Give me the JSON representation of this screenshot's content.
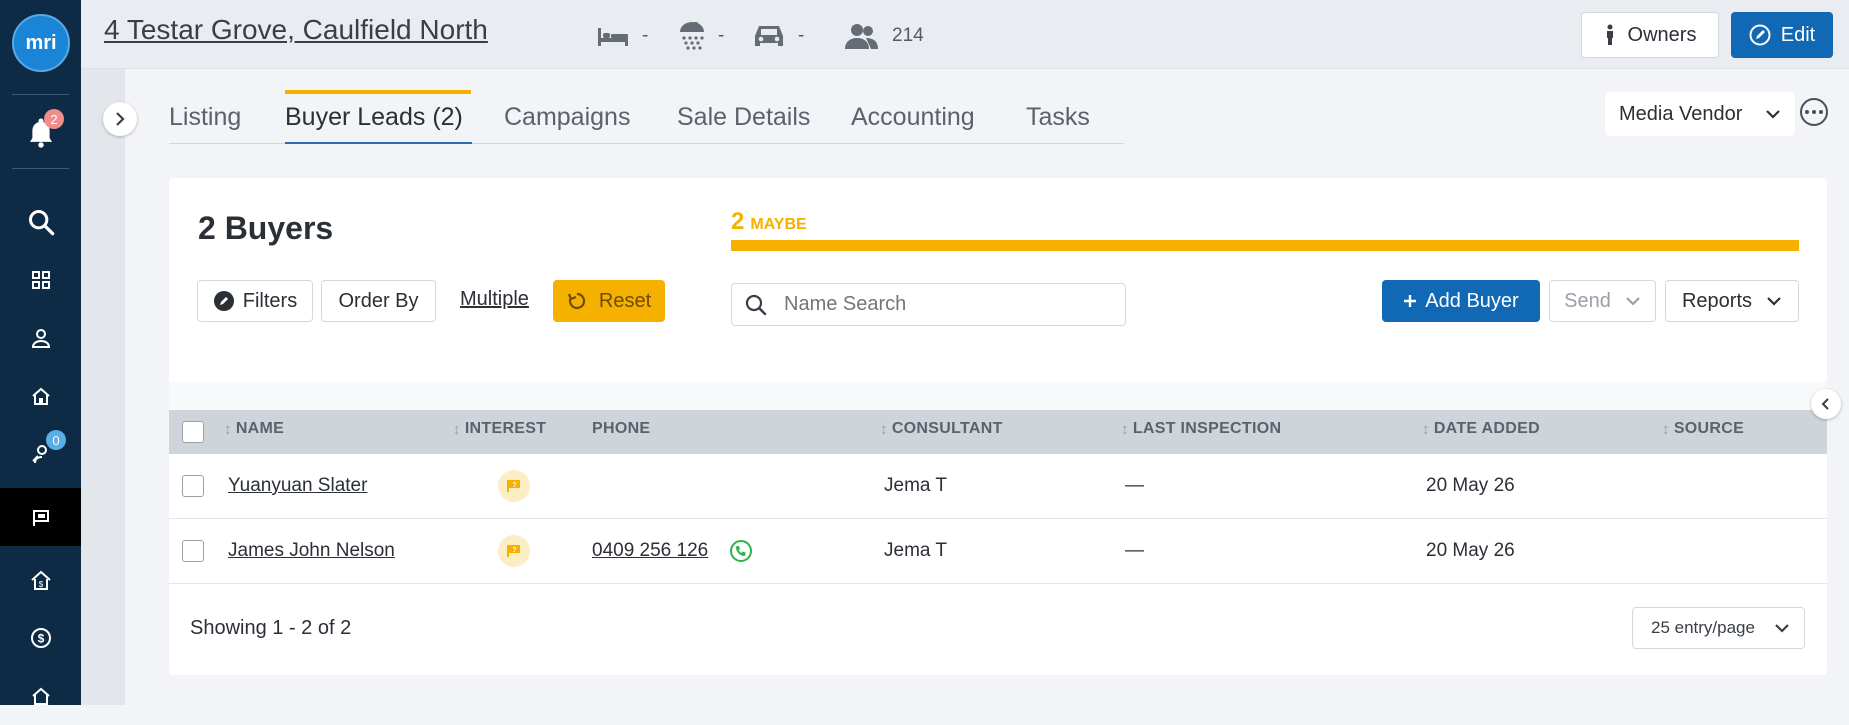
{
  "app": {
    "logo_text": "mri",
    "notifications_count": "2",
    "tasks_count": "0"
  },
  "colors": {
    "sidebar": "#0d2b45",
    "accent_blue": "#1168b4",
    "maybe_yellow": "#f5b000"
  },
  "sidebar": {
    "items": [
      {
        "icon": "bell-icon"
      },
      {
        "icon": "search-icon"
      },
      {
        "icon": "grid-icon"
      },
      {
        "icon": "person-icon"
      },
      {
        "icon": "home-icon"
      },
      {
        "icon": "key-person-icon"
      },
      {
        "icon": "listing-sign-icon"
      },
      {
        "icon": "house-dollar-icon"
      },
      {
        "icon": "dollar-circle-icon"
      },
      {
        "icon": "house-icon"
      }
    ]
  },
  "header": {
    "address": "4 Testar Grove, Caulfield North",
    "bedrooms": "-",
    "bathrooms": "-",
    "carspaces": "-",
    "contacts": "214",
    "owners_label": "Owners",
    "edit_label": "Edit"
  },
  "tabs": [
    {
      "label": "Listing"
    },
    {
      "label": "Buyer Leads (2)"
    },
    {
      "label": "Campaigns"
    },
    {
      "label": "Sale Details"
    },
    {
      "label": "Accounting"
    },
    {
      "label": "Tasks"
    }
  ],
  "vendor_select": {
    "label": "Media Vendor"
  },
  "buyers": {
    "title": "2 Buyers",
    "maybe_count": "2",
    "maybe_label": "MAYBE",
    "maybe_fraction": 1.0,
    "filters_label": "Filters",
    "order_by_label": "Order By",
    "multiple_label": "Multiple",
    "reset_label": "Reset",
    "search_placeholder": "Name Search",
    "add_buyer_label": "Add Buyer",
    "send_label": "Send",
    "reports_label": "Reports"
  },
  "table": {
    "headers": {
      "name": "NAME",
      "interest": "INTEREST",
      "phone": "PHONE",
      "consultant": "CONSULTANT",
      "last_inspection": "LAST INSPECTION",
      "date_added": "DATE ADDED",
      "source": "SOURCE"
    },
    "rows": [
      {
        "name": "Yuanyuan Slater",
        "interest": "maybe",
        "phone": "",
        "consultant": "Jema T",
        "last_inspection": "—",
        "date_added": "20 May 26",
        "source": ""
      },
      {
        "name": "James John Nelson",
        "interest": "maybe",
        "phone": "0409 256 126",
        "consultant": "Jema T",
        "last_inspection": "—",
        "date_added": "20 May 26",
        "source": ""
      }
    ]
  },
  "pagination": {
    "summary": "Showing 1 - 2 of 2",
    "per_page": "25 entry/page"
  }
}
